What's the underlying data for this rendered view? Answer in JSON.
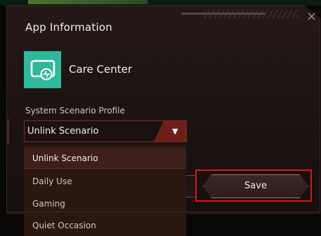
{
  "dialog": {
    "title": "App Information",
    "close_symbol": "×"
  },
  "app": {
    "name": "Care Center",
    "icon": "care-center-monitor-icon",
    "icon_color": "#2fb89a"
  },
  "profile": {
    "label": "System Scenario Profile",
    "selected": "Unlink Scenario",
    "options": [
      "Unlink Scenario",
      "Daily Use",
      "Gaming",
      "Quiet Occasion"
    ]
  },
  "actions": {
    "save_label": "Save"
  },
  "colors": {
    "accent": "#6e1f1a",
    "highlight": "#e0141a",
    "background": "#1b1312"
  }
}
